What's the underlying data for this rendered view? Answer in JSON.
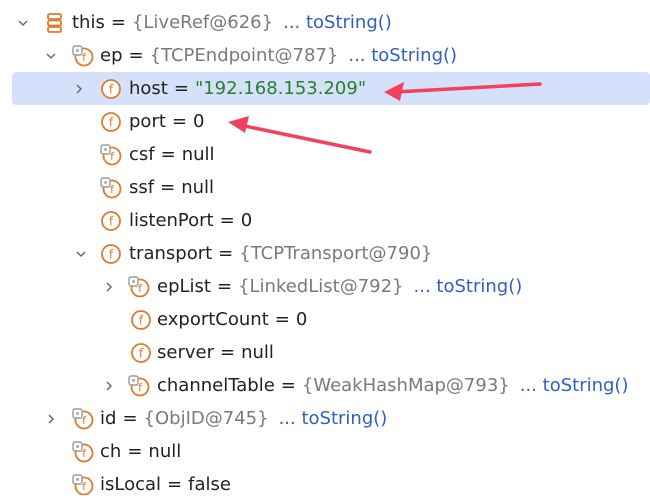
{
  "colors": {
    "field_icon": "#e2792b",
    "array_icon": "#e2792b",
    "arrow": "#f2415c",
    "selected_row": "#d5e1fb",
    "string_value": "#2a7d2a",
    "link": "#2f5ec7"
  },
  "rows": {
    "this": {
      "name": "this",
      "eq": "=",
      "ref": "{LiveRef@626}",
      "link": "... toString()"
    },
    "ep": {
      "name": "ep",
      "eq": "=",
      "ref": "{TCPEndpoint@787}",
      "link": "... toString()"
    },
    "host": {
      "name": "host",
      "eq": "=",
      "value": "\"192.168.153.209\""
    },
    "port": {
      "name": "port",
      "eq": "=",
      "value": "0"
    },
    "csf": {
      "name": "csf",
      "eq": "=",
      "value": "null"
    },
    "ssf": {
      "name": "ssf",
      "eq": "=",
      "value": "null"
    },
    "listenPort": {
      "name": "listenPort",
      "eq": "=",
      "value": "0"
    },
    "transport": {
      "name": "transport",
      "eq": "=",
      "ref": "{TCPTransport@790}"
    },
    "epList": {
      "name": "epList",
      "eq": "=",
      "ref": "{LinkedList@792}",
      "link": "... toString()"
    },
    "exportCount": {
      "name": "exportCount",
      "eq": "=",
      "value": "0"
    },
    "server": {
      "name": "server",
      "eq": "=",
      "value": "null"
    },
    "channelTable": {
      "name": "channelTable",
      "eq": "=",
      "ref": "{WeakHashMap@793}",
      "link": "... toString()"
    },
    "id": {
      "name": "id",
      "eq": "=",
      "ref": "{ObjID@745}",
      "link": "... toString()"
    },
    "ch": {
      "name": "ch",
      "eq": "=",
      "value": "null"
    },
    "isLocal": {
      "name": "isLocal",
      "eq": "=",
      "value": "false"
    }
  },
  "icons": {
    "this": "array-icon",
    "ep": "field-locked-icon",
    "host": "field-icon",
    "port": "field-icon",
    "csf": "field-locked-icon",
    "ssf": "field-locked-icon",
    "listenPort": "field-icon",
    "transport": "field-icon",
    "epList": "field-locked-icon",
    "exportCount": "field-icon",
    "server": "field-icon",
    "channelTable": "field-locked-icon",
    "id": "field-locked-icon",
    "ch": "field-locked-icon",
    "isLocal": "field-locked-icon"
  }
}
